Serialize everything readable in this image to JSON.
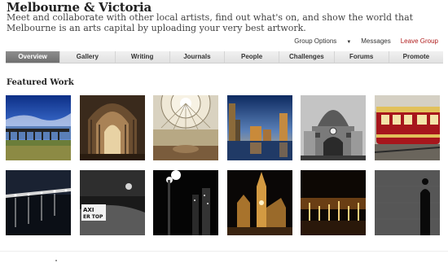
{
  "group": {
    "title": "Melbourne & Victoria",
    "description": "Meet and collaborate with other local artists, find out what's on, and show the world that Melbourne is an arts capital by uploading your very best artwork."
  },
  "actions": {
    "group_options": "Group Options",
    "messages": "Messages",
    "leave_group": "Leave Group"
  },
  "tabs": [
    {
      "label": "Overview",
      "active": true
    },
    {
      "label": "Gallery"
    },
    {
      "label": "Writing"
    },
    {
      "label": "Journals"
    },
    {
      "label": "People"
    },
    {
      "label": "Challenges"
    },
    {
      "label": "Forums"
    },
    {
      "label": "Promote"
    }
  ],
  "featured": {
    "title": "Featured Work",
    "items": [
      {
        "subject": "blue-sky-pier"
      },
      {
        "subject": "gothic-cathedral-interior"
      },
      {
        "subject": "library-dome"
      },
      {
        "subject": "city-skyline-water"
      },
      {
        "subject": "flinders-street-station"
      },
      {
        "subject": "red-tram"
      },
      {
        "subject": "night-pier-lights"
      },
      {
        "subject": "taxi-top-sign"
      },
      {
        "subject": "night-lamps"
      },
      {
        "subject": "golden-church-night"
      },
      {
        "subject": "fountains-night"
      },
      {
        "subject": "silhouette-wall"
      }
    ]
  },
  "colors": {
    "active_tab": "#7d7d7d",
    "leave_group": "#b01e1e"
  }
}
